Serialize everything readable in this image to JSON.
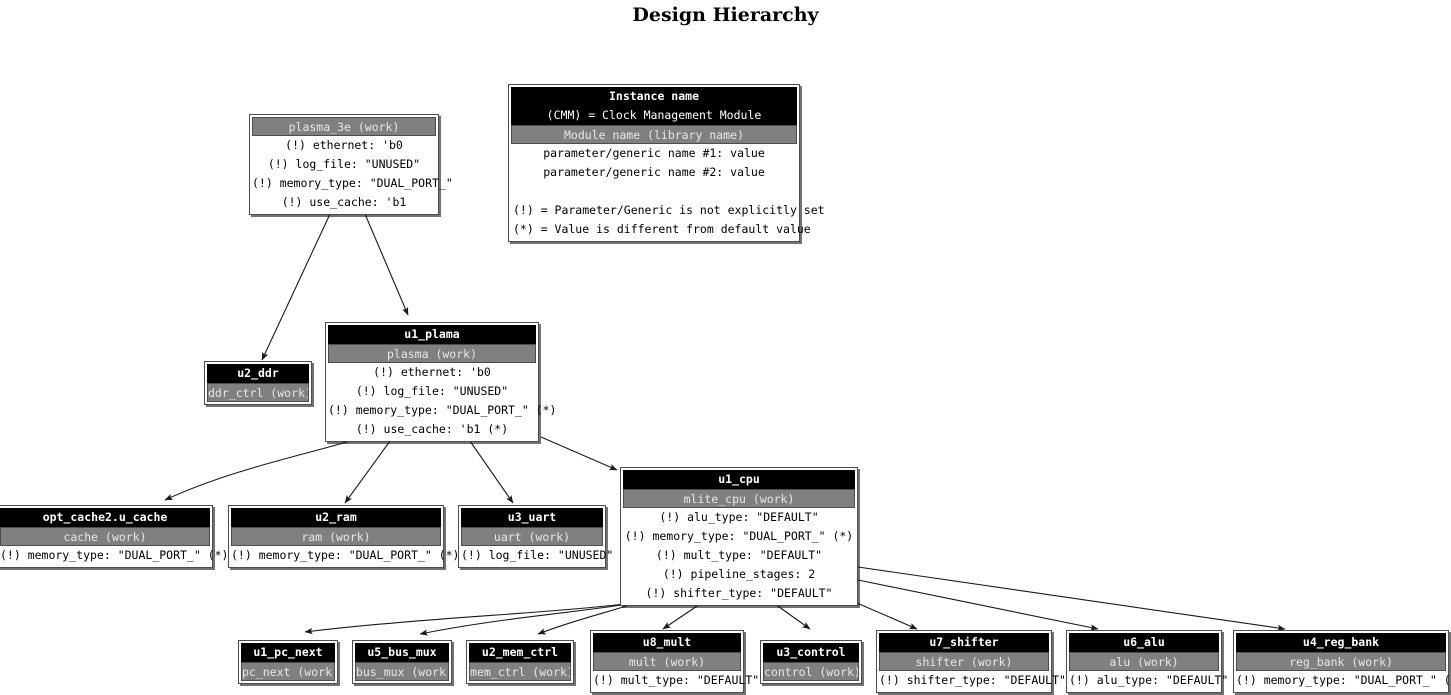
{
  "title": "Design Hierarchy",
  "legend": {
    "instance_label": "Instance name",
    "cmm_note": "(CMM) = Clock Management Module",
    "module_label": "Module name (library name)",
    "param1": "parameter/generic name #1: value",
    "param2": "parameter/generic name #2: value",
    "note_bang": "(!) = Parameter/Generic is not explicitly set",
    "note_star": "(*) = Value is different from default value"
  },
  "colors": {
    "instance_bar": "#000000",
    "instance_text": "#ffffff",
    "module_bar": "#808080",
    "module_text": "#e8e8e8",
    "box_border": "#4d4d4d",
    "background": "#ffffff",
    "edge": "#1a1a1a"
  },
  "nodes": [
    {
      "id": "plasma_3e",
      "instance": "",
      "module": "plasma_3e (work)",
      "params": [
        "(!) ethernet: 'b0",
        "(!) log_file: \"UNUSED\"",
        "(!) memory_type: \"DUAL_PORT_\"",
        "(!) use_cache: 'b1"
      ]
    },
    {
      "id": "u1_plama",
      "instance": "u1_plama",
      "module": "plasma (work)",
      "params": [
        "(!) ethernet: 'b0",
        "(!) log_file: \"UNUSED\"",
        "(!) memory_type: \"DUAL_PORT_\" (*)",
        "(!) use_cache: 'b1 (*)"
      ]
    },
    {
      "id": "u2_ddr",
      "instance": "u2_ddr",
      "module": "ddr_ctrl (work)",
      "params": []
    },
    {
      "id": "opt_cache2_u_cache",
      "instance": "opt_cache2.u_cache",
      "module": "cache (work)",
      "params": [
        "(!) memory_type: \"DUAL_PORT_\" (*)"
      ]
    },
    {
      "id": "u2_ram",
      "instance": "u2_ram",
      "module": "ram (work)",
      "params": [
        "(!) memory_type: \"DUAL_PORT_\" (*)"
      ]
    },
    {
      "id": "u3_uart",
      "instance": "u3_uart",
      "module": "uart (work)",
      "params": [
        "(!) log_file: \"UNUSED\""
      ]
    },
    {
      "id": "u1_cpu",
      "instance": "u1_cpu",
      "module": "mlite_cpu (work)",
      "params": [
        "(!) alu_type: \"DEFAULT\"",
        "(!) memory_type: \"DUAL_PORT_\" (*)",
        "(!) mult_type: \"DEFAULT\"",
        "(!) pipeline_stages: 2",
        "(!) shifter_type: \"DEFAULT\""
      ]
    },
    {
      "id": "u1_pc_next",
      "instance": "u1_pc_next",
      "module": "pc_next (work)",
      "params": []
    },
    {
      "id": "u5_bus_mux",
      "instance": "u5_bus_mux",
      "module": "bus_mux (work)",
      "params": []
    },
    {
      "id": "u2_mem_ctrl",
      "instance": "u2_mem_ctrl",
      "module": "mem_ctrl (work)",
      "params": []
    },
    {
      "id": "u8_mult",
      "instance": "u8_mult",
      "module": "mult (work)",
      "params": [
        "(!) mult_type: \"DEFAULT\""
      ]
    },
    {
      "id": "u3_control",
      "instance": "u3_control",
      "module": "control (work)",
      "params": []
    },
    {
      "id": "u7_shifter",
      "instance": "u7_shifter",
      "module": "shifter (work)",
      "params": [
        "(!) shifter_type: \"DEFAULT\""
      ]
    },
    {
      "id": "u6_alu",
      "instance": "u6_alu",
      "module": "alu (work)",
      "params": [
        "(!) alu_type: \"DEFAULT\""
      ]
    },
    {
      "id": "u4_reg_bank",
      "instance": "u4_reg_bank",
      "module": "reg_bank (work)",
      "params": [
        "(!) memory_type: \"DUAL_PORT_\" (*)"
      ]
    }
  ]
}
